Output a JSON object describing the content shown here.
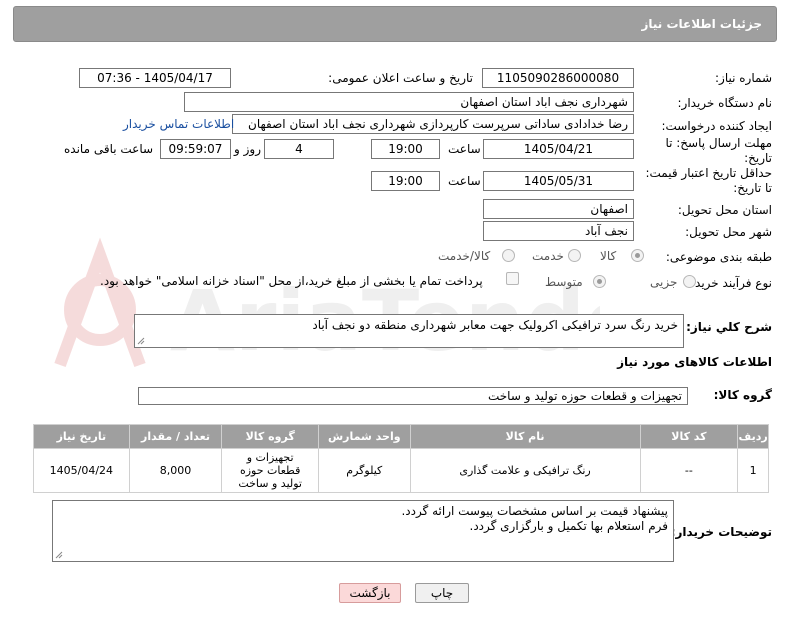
{
  "header": {
    "title": "جزئیات اطلاعات نیاز"
  },
  "fields": {
    "need_number_label": "شماره نیاز:",
    "need_number": "1105090286000080",
    "announce_label": "تاریخ و ساعت اعلان عمومی:",
    "announce_value": "1405/04/17 - 07:36",
    "buyer_org_label": "نام دستگاه خریدار:",
    "buyer_org": "شهرداری نجف اباد استان اصفهان",
    "creator_label": "ایجاد کننده درخواست:",
    "creator": "رضا خدادادی ساداتی سرپرست  کارپردازی شهرداری نجف اباد استان اصفهان",
    "contact_link": "اطلاعات تماس خریدار",
    "deadline_label": "مهلت ارسال پاسخ: تا تاریخ:",
    "deadline_date": "1405/04/21",
    "time_label": "ساعت",
    "deadline_time": "19:00",
    "days_value": "4",
    "days_label": "روز و",
    "remaining_time": "09:59:07",
    "remaining_label": "ساعت باقی مانده",
    "validity_label": "حداقل تاریخ اعتبار قیمت: تا تاریخ:",
    "validity_date": "1405/05/31",
    "validity_time": "19:00",
    "province_label": "استان محل تحویل:",
    "province": "اصفهان",
    "city_label": "شهر محل تحویل:",
    "city": "نجف آباد",
    "category_label": "طبقه بندی موضوعی:",
    "category_options": [
      "کالا",
      "خدمت",
      "کالا/خدمت"
    ],
    "process_label": "نوع فرآیند خرید :",
    "process_options": [
      "جزیی",
      "متوسط"
    ],
    "payment_note": "پرداخت تمام یا بخشی از مبلغ خرید،از محل \"اسناد خزانه اسلامی\" خواهد بود."
  },
  "description": {
    "label": "شرح کلي نياز:",
    "value": "خرید رنگ سرد ترافیکی اکرولیک جهت معابر شهرداری منطقه دو نجف آباد"
  },
  "goods_section": {
    "title": "اطلاعات کالاهای مورد نیاز",
    "group_label": "گروه کالا:",
    "group_value": "تجهیزات و قطعات حوزه تولید و ساخت"
  },
  "table": {
    "headers": [
      "ردیف",
      "کد کالا",
      "نام کالا",
      "واحد شمارش",
      "گروه کالا",
      "تعداد / مقدار",
      "تاریخ نیاز"
    ],
    "rows": [
      {
        "row": "1",
        "code": "--",
        "name": "رنگ ترافیکی و علامت گذاری",
        "unit": "کیلوگرم",
        "group": "تجهیزات و قطعات حوزه تولید و ساخت",
        "qty": "8,000",
        "date": "1405/04/24"
      }
    ]
  },
  "buyer_notes": {
    "label": "توضیحات خریدار:",
    "line1": "پیشنهاد قیمت بر اساس مشخصات پیوست ارائه گردد.",
    "line2": "فرم استعلام بها تکمیل و بارگزاری گردد."
  },
  "buttons": {
    "print": "چاپ",
    "back": "بازگشت"
  },
  "watermark": {
    "text": "AriaTender.neT"
  },
  "colors": {
    "header_bg": "#9f9f9f",
    "link": "#1a4fa0",
    "back_button": "#fbd9d9"
  }
}
